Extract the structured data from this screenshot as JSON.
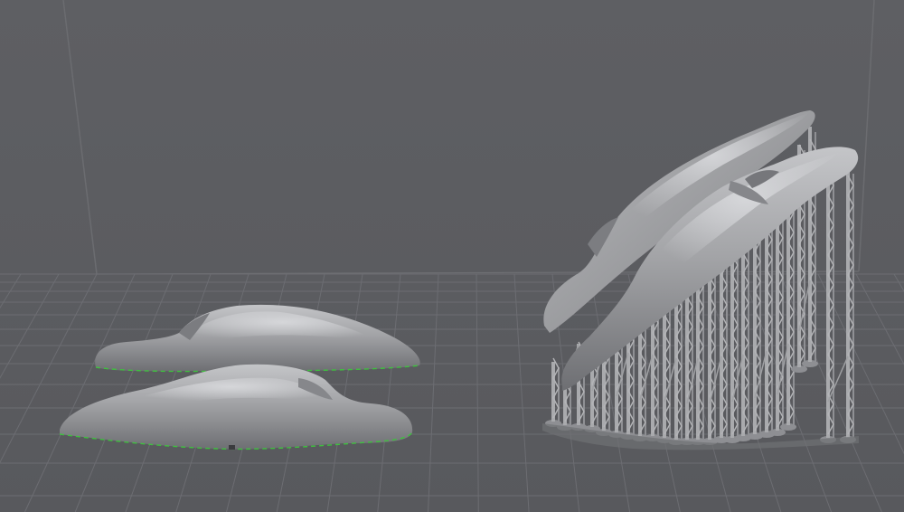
{
  "scene": {
    "view": "3d-print-preview",
    "background_color": "#5d5e62",
    "grid_color": "#6c6d72",
    "model_color": "#a4a5a8",
    "support_color": "#a9aaad",
    "outline_color": "#3fbf3f",
    "models": [
      {
        "name": "flat-part-back",
        "supports": false
      },
      {
        "name": "flat-part-front",
        "supports": false
      },
      {
        "name": "tilted-part-back",
        "supports": true
      },
      {
        "name": "tilted-part-front",
        "supports": true
      }
    ]
  }
}
